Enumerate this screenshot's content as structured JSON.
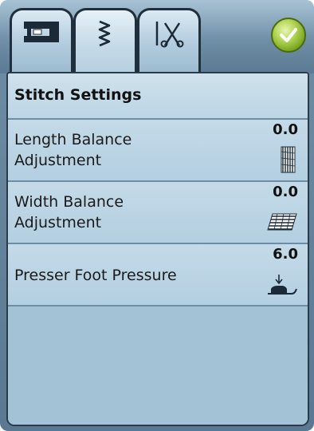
{
  "tabs": [
    {
      "id": "machine",
      "icon": "sewing-machine-icon"
    },
    {
      "id": "stitch",
      "icon": "zigzag-stitch-icon",
      "active": true
    },
    {
      "id": "tools",
      "icon": "needle-scissors-icon"
    }
  ],
  "ok_button": {
    "icon": "checkmark-icon",
    "color": "#8ab52a"
  },
  "header": {
    "title": "Stitch Settings"
  },
  "settings": [
    {
      "label_line1": "Length Balance",
      "label_line2": "Adjustment",
      "value": "0.0",
      "icon": "length-balance-icon"
    },
    {
      "label_line1": "Width Balance",
      "label_line2": "Adjustment",
      "value": "0.0",
      "icon": "width-balance-icon"
    },
    {
      "label": "Presser Foot Pressure",
      "value": "6.0",
      "icon": "presser-foot-icon"
    }
  ]
}
